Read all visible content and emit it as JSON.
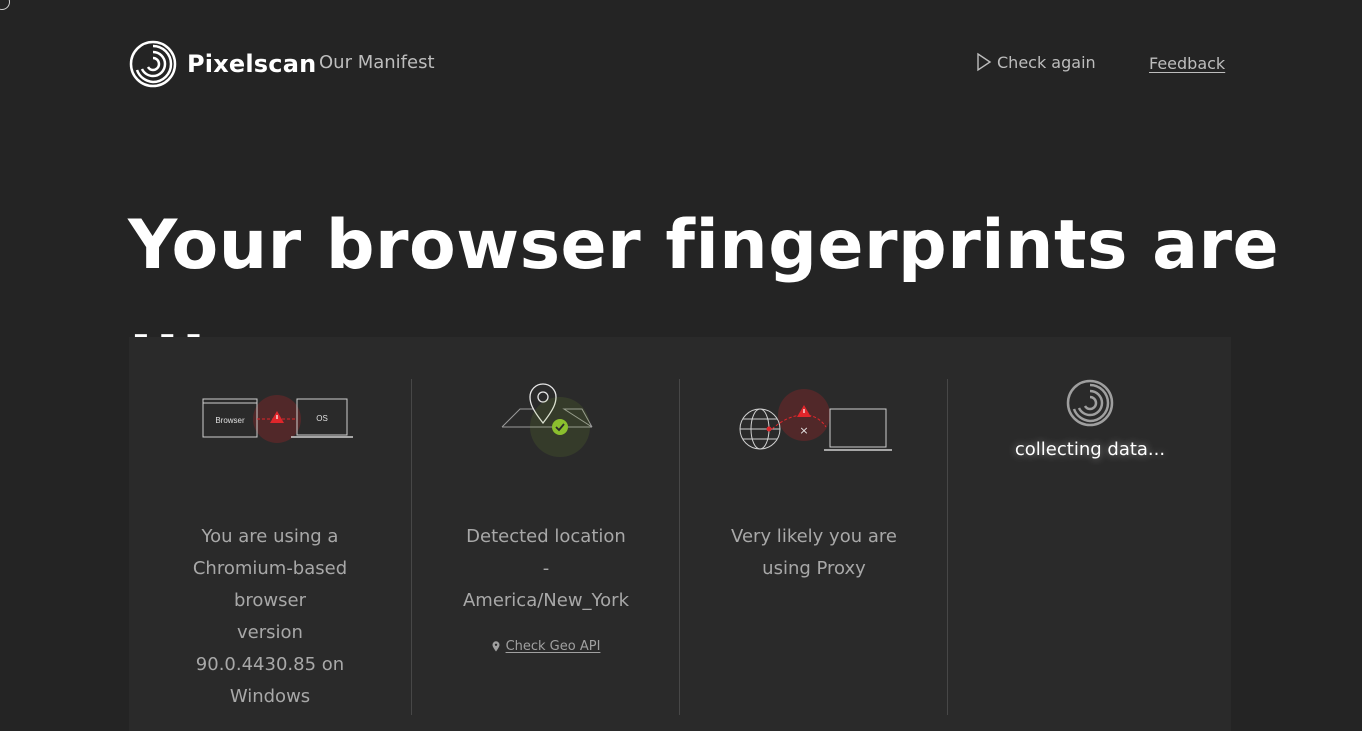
{
  "header": {
    "brand": "Pixelscan",
    "nav_link": "Our Manifest",
    "check_again": "Check again",
    "feedback": "Feedback"
  },
  "headline": "Your browser fingerprints are ...",
  "results": {
    "browser": {
      "illus_browser_label": "Browser",
      "illus_os_label": "OS",
      "lines": [
        "You are using a",
        "Chromium-based",
        "browser",
        "version",
        "90.0.4430.85 on",
        "Windows"
      ]
    },
    "location": {
      "lines": [
        "Detected location",
        "-",
        "America/New_York"
      ],
      "geo_link": "Check Geo API"
    },
    "proxy": {
      "lines": [
        "Very likely you are",
        "using Proxy"
      ]
    },
    "collecting": {
      "text": "collecting data..."
    }
  },
  "colors": {
    "background": "#242424",
    "panel": "#2a2a2a",
    "warning_red": "#e0262b",
    "ok_green": "#8bbf2e"
  },
  "icons": [
    "pixelscan-logo-icon",
    "play-icon",
    "warning-icon",
    "map-pin-icon",
    "check-icon",
    "globe-icon",
    "laptop-icon",
    "loading-spiral-icon"
  ]
}
